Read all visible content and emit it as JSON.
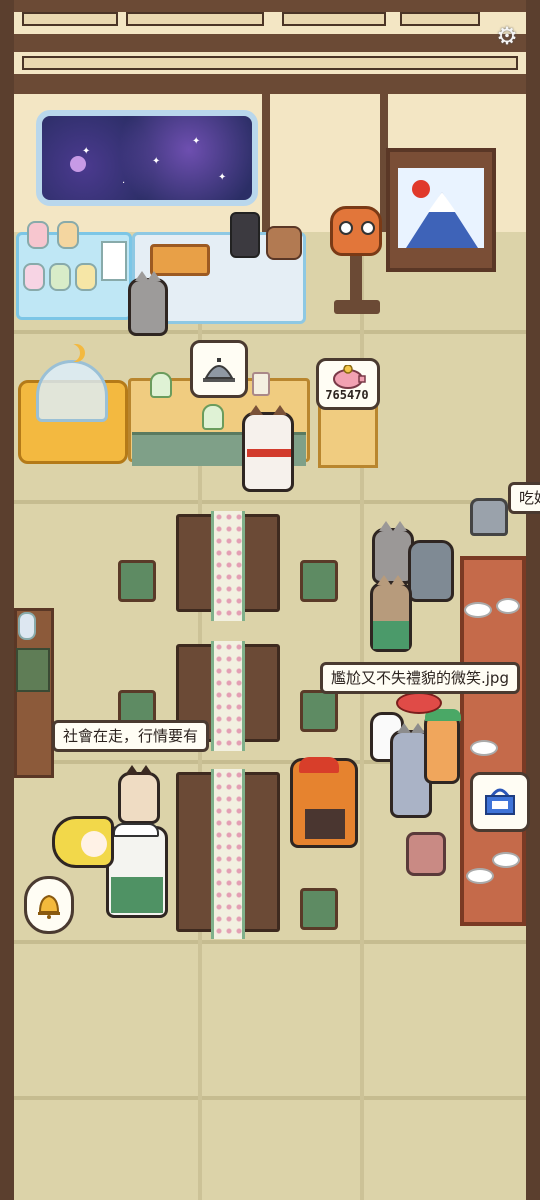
{
  "hud": {
    "settings_icon": "gear-icon",
    "settings_glyph": "⚙"
  },
  "shop": {
    "cash_amount": "765470",
    "service_bell_icon": "service-bell-icon",
    "piggy_bank_icon": "piggy-bank-icon"
  },
  "speech": {
    "awkward_smile": "尷尬又不失禮貌的微笑.jpg",
    "society_line": "社會在走，行情要有",
    "cut_off_right": "吃好"
  },
  "customer_requests": {
    "bell_icon": "bell-icon",
    "shopping_basket_icon": "shopping-basket-icon"
  },
  "colors": {
    "floor": "#dcd3a9",
    "wall": "#f3e6c4",
    "wood_dark": "#6b4a35",
    "bubble_border": "#4a3a30"
  }
}
